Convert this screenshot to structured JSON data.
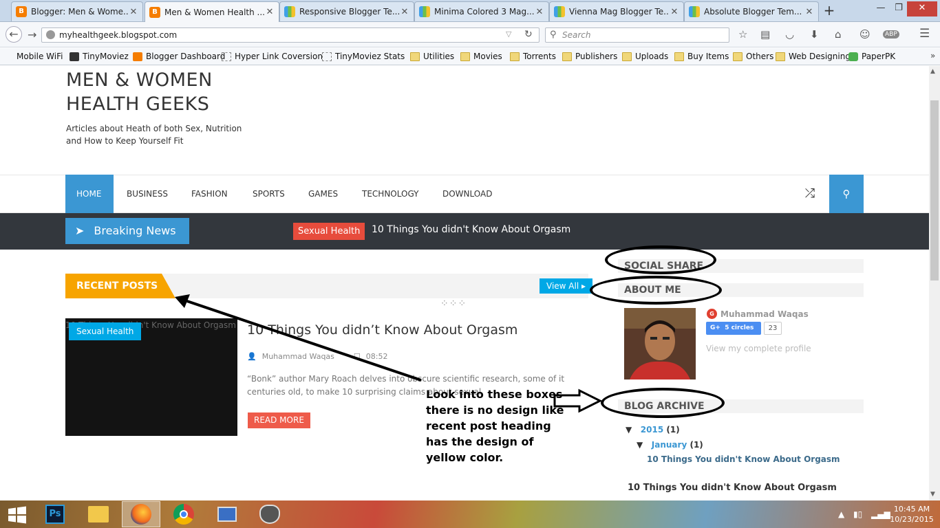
{
  "browser": {
    "tabs": [
      {
        "label": "Blogger: Men & Wome...",
        "icon": "blogger-icon"
      },
      {
        "label": "Men & Women Health ...",
        "icon": "blogger-icon",
        "active": true
      },
      {
        "label": "Responsive Blogger Te...",
        "icon": "theme-icon"
      },
      {
        "label": "Minima Colored 3 Mag...",
        "icon": "theme-icon"
      },
      {
        "label": "Vienna Mag Blogger Te...",
        "icon": "theme-icon"
      },
      {
        "label": "Absolute Blogger Tem...",
        "icon": "theme-icon"
      }
    ],
    "url": "myhealthgeek.blogspot.com",
    "search_placeholder": "Search",
    "bookmarks": [
      {
        "label": "Mobile WiFi",
        "icon": "page"
      },
      {
        "label": "TinyMoviez",
        "icon": "site"
      },
      {
        "label": "Blogger Dashboard",
        "icon": "blogger"
      },
      {
        "label": "Hyper Link Coversion",
        "icon": "page"
      },
      {
        "label": "TinyMoviez Stats",
        "icon": "page"
      },
      {
        "label": "Utilities",
        "icon": "folder"
      },
      {
        "label": "Movies",
        "icon": "folder"
      },
      {
        "label": "Torrents",
        "icon": "folder"
      },
      {
        "label": "Publishers",
        "icon": "folder"
      },
      {
        "label": "Uploads",
        "icon": "folder"
      },
      {
        "label": "Buy Items",
        "icon": "folder"
      },
      {
        "label": "Others",
        "icon": "folder"
      },
      {
        "label": "Web Designing",
        "icon": "folder"
      },
      {
        "label": "PaperPK",
        "icon": "chat"
      }
    ]
  },
  "site": {
    "title_line1": "MEN & WOMEN",
    "title_line2": "HEALTH GEEKS",
    "description": "Articles about Heath of both Sex, Nutrition and How to Keep Yourself Fit",
    "menu": [
      "HOME",
      "BUSINESS",
      "FASHION",
      "SPORTS",
      "GAMES",
      "TECHNOLOGY",
      "DOWNLOAD"
    ],
    "breaking": {
      "label": "Breaking News",
      "tag": "Sexual Health",
      "headline": "10 Things You didn't Know About Orgasm"
    }
  },
  "recent": {
    "heading": "RECENT POSTS",
    "view_all": "View All",
    "thumb_alt": "10 Things You didn't Know About Orgasm",
    "tag": "Sexual Health",
    "title": "10 Things You didn’t Know About Orgasm",
    "author": "Muhammad Waqas",
    "time": "08:52",
    "excerpt": "“Bonk” author Mary Roach delves into obscure scientific research, some of it centuries old, to make 10 surprising claims about sexual",
    "read_more": "READ MORE"
  },
  "sidebar": {
    "social_share": "SOCIAL SHARE",
    "about_me": "ABOUT ME",
    "profile_name": "Muhammad Waqas",
    "circles_label": "5 circles",
    "circles_count": "23",
    "view_profile": "View my complete profile",
    "blog_archive": "BLOG ARCHIVE",
    "archive_year": "2015",
    "archive_year_count": "(1)",
    "archive_month": "January",
    "archive_month_count": "(1)",
    "archive_post": "10 Things You didn't Know About Orgasm",
    "popular_title": "10 Things You didn't Know About Orgasm"
  },
  "annotation": "Look into these boxes there is no design like recent post heading has the design of yellow color.",
  "taskbar": {
    "time": "10:45 AM",
    "date": "10/23/2015",
    "apps": [
      "photoshop-icon",
      "file-explorer-icon",
      "firefox-icon",
      "chrome-icon",
      "remote-desktop-icon",
      "app-icon"
    ]
  },
  "colors": {
    "accent_blue": "#3b97d3",
    "recent_yellow": "#f7a400",
    "tag_red": "#e74c3c",
    "tag_cyan": "#00a8e6"
  }
}
